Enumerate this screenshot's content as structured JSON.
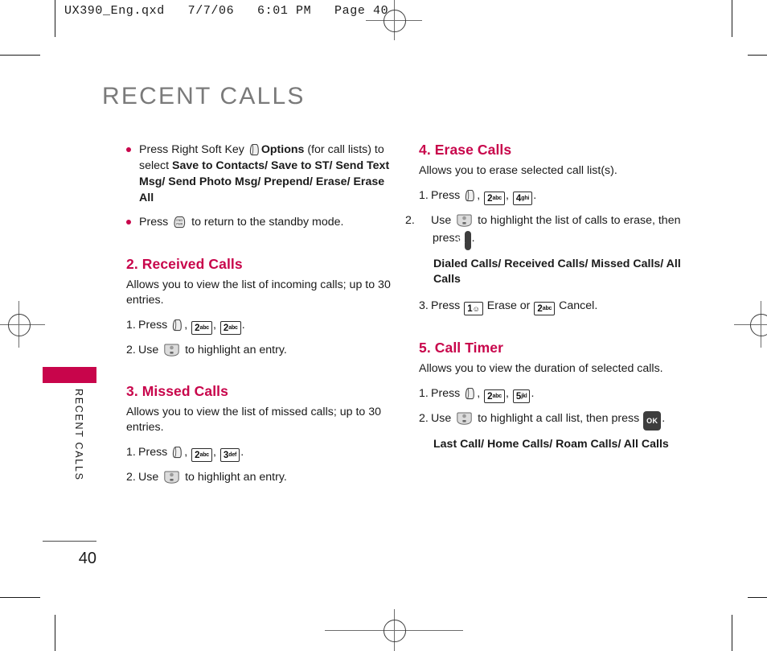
{
  "prepress": {
    "header_text": "UX390_Eng.qxd   7/7/06   6:01 PM   Page 40"
  },
  "page": {
    "title": "RECENT CALLS",
    "side_tab_label": "RECENT CALLS",
    "page_number": "40",
    "accent_color": "#c8054b",
    "title_color": "#7a7a7a"
  },
  "icons": {
    "soft_key": "right-soft-key-icon",
    "end_key": "end-key-icon",
    "nav_key": "navigation-key-icon",
    "ok_key": "ok-key-icon",
    "key_1_label": "1",
    "key_1_sub": "voicemail",
    "key_2_label": "2",
    "key_2_sub": "abc",
    "key_3_label": "3",
    "key_3_sub": "def",
    "key_4_label": "4",
    "key_4_sub": "ghi",
    "key_5_label": "5",
    "key_5_sub": "jkl",
    "ok_label": "OK"
  },
  "left_column": {
    "bullet1": {
      "t1": "Press Right Soft Key ",
      "t2": "Options",
      "t3": " (for call lists) to select ",
      "t4": "Save to Contacts/ Save to ST/ Send Text Msg/ Send Photo Msg/ Prepend/ Erase/ Erase All"
    },
    "bullet2": {
      "t1": "Press ",
      "t2": " to return to the standby mode."
    },
    "section2": {
      "heading": "2. Received Calls",
      "intro": "Allows you to view the list of incoming calls; up to 30 entries.",
      "step1_num": "1.",
      "step1_pre": "Press ",
      "step1_mid": ", ",
      "step1_mid2": ", ",
      "step1_end": ".",
      "step2_num": "2.",
      "step2_pre": "Use ",
      "step2_post": " to highlight an entry."
    },
    "section3": {
      "heading": "3. Missed Calls",
      "intro": "Allows you to view the list of missed calls; up to 30 entries.",
      "step1_num": "1.",
      "step1_pre": "Press ",
      "step1_mid": ", ",
      "step1_mid2": ", ",
      "step1_end": ".",
      "step2_num": "2.",
      "step2_pre": "Use ",
      "step2_post": " to highlight an entry."
    }
  },
  "right_column": {
    "section4": {
      "heading": "4. Erase Calls",
      "intro": "Allows you to erase selected call list(s).",
      "step1_num": "1.",
      "step1_pre": "Press ",
      "step1_mid": ", ",
      "step1_mid2": ", ",
      "step1_end": ".",
      "step2_num": "2.",
      "step2_pre": "Use ",
      "step2_mid": " to highlight the list of calls to erase, then press ",
      "step2_end": ".",
      "options": "Dialed Calls/ Received Calls/ Missed Calls/ All Calls",
      "step3_num": "3.",
      "step3_pre": "Press ",
      "step3_mid": " Erase or ",
      "step3_end": " Cancel."
    },
    "section5": {
      "heading": "5. Call Timer",
      "intro": "Allows you to view the duration of selected calls.",
      "step1_num": "1.",
      "step1_pre": "Press ",
      "step1_mid": ", ",
      "step1_mid2": ", ",
      "step1_end": ".",
      "step2_num": "2.",
      "step2_pre": "Use ",
      "step2_mid": " to highlight a call list, then press ",
      "step2_end": ".",
      "options": "Last Call/ Home Calls/ Roam Calls/ All Calls"
    }
  }
}
